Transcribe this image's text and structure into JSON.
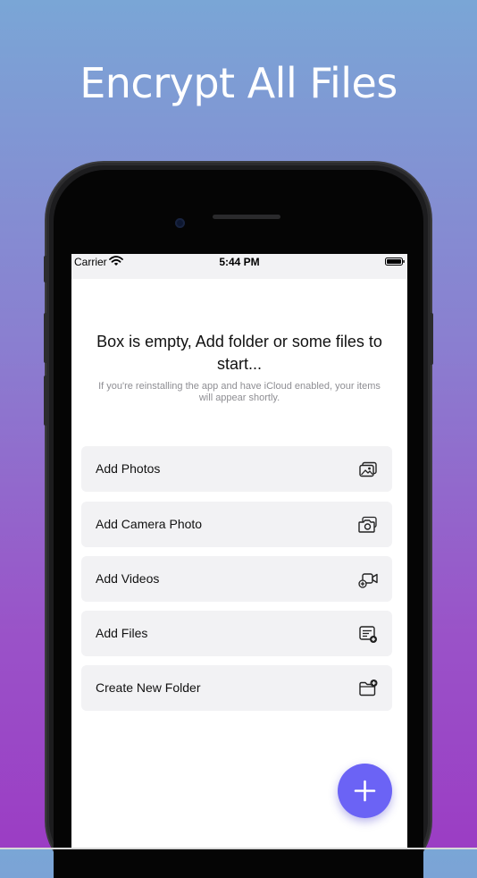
{
  "headline": "Encrypt All Files",
  "status_bar": {
    "carrier": "Carrier",
    "time": "5:44 PM"
  },
  "empty_state": {
    "title": "Box is empty, Add folder or some files to start...",
    "subtitle": "If you're reinstalling the app and have iCloud enabled, your items will appear shortly."
  },
  "actions": [
    {
      "label": "Add Photos",
      "icon": "photos-icon"
    },
    {
      "label": "Add Camera Photo",
      "icon": "camera-icon"
    },
    {
      "label": "Add Videos",
      "icon": "video-add-icon"
    },
    {
      "label": "Add Files",
      "icon": "file-add-icon"
    },
    {
      "label": "Create New Folder",
      "icon": "folder-add-icon"
    }
  ],
  "fab": {
    "icon": "plus-icon"
  },
  "colors": {
    "accent": "#6b63f5",
    "row_background": "#f2f2f4",
    "gradient_top": "#7aa6d6",
    "gradient_bottom": "#9b3dc4"
  }
}
